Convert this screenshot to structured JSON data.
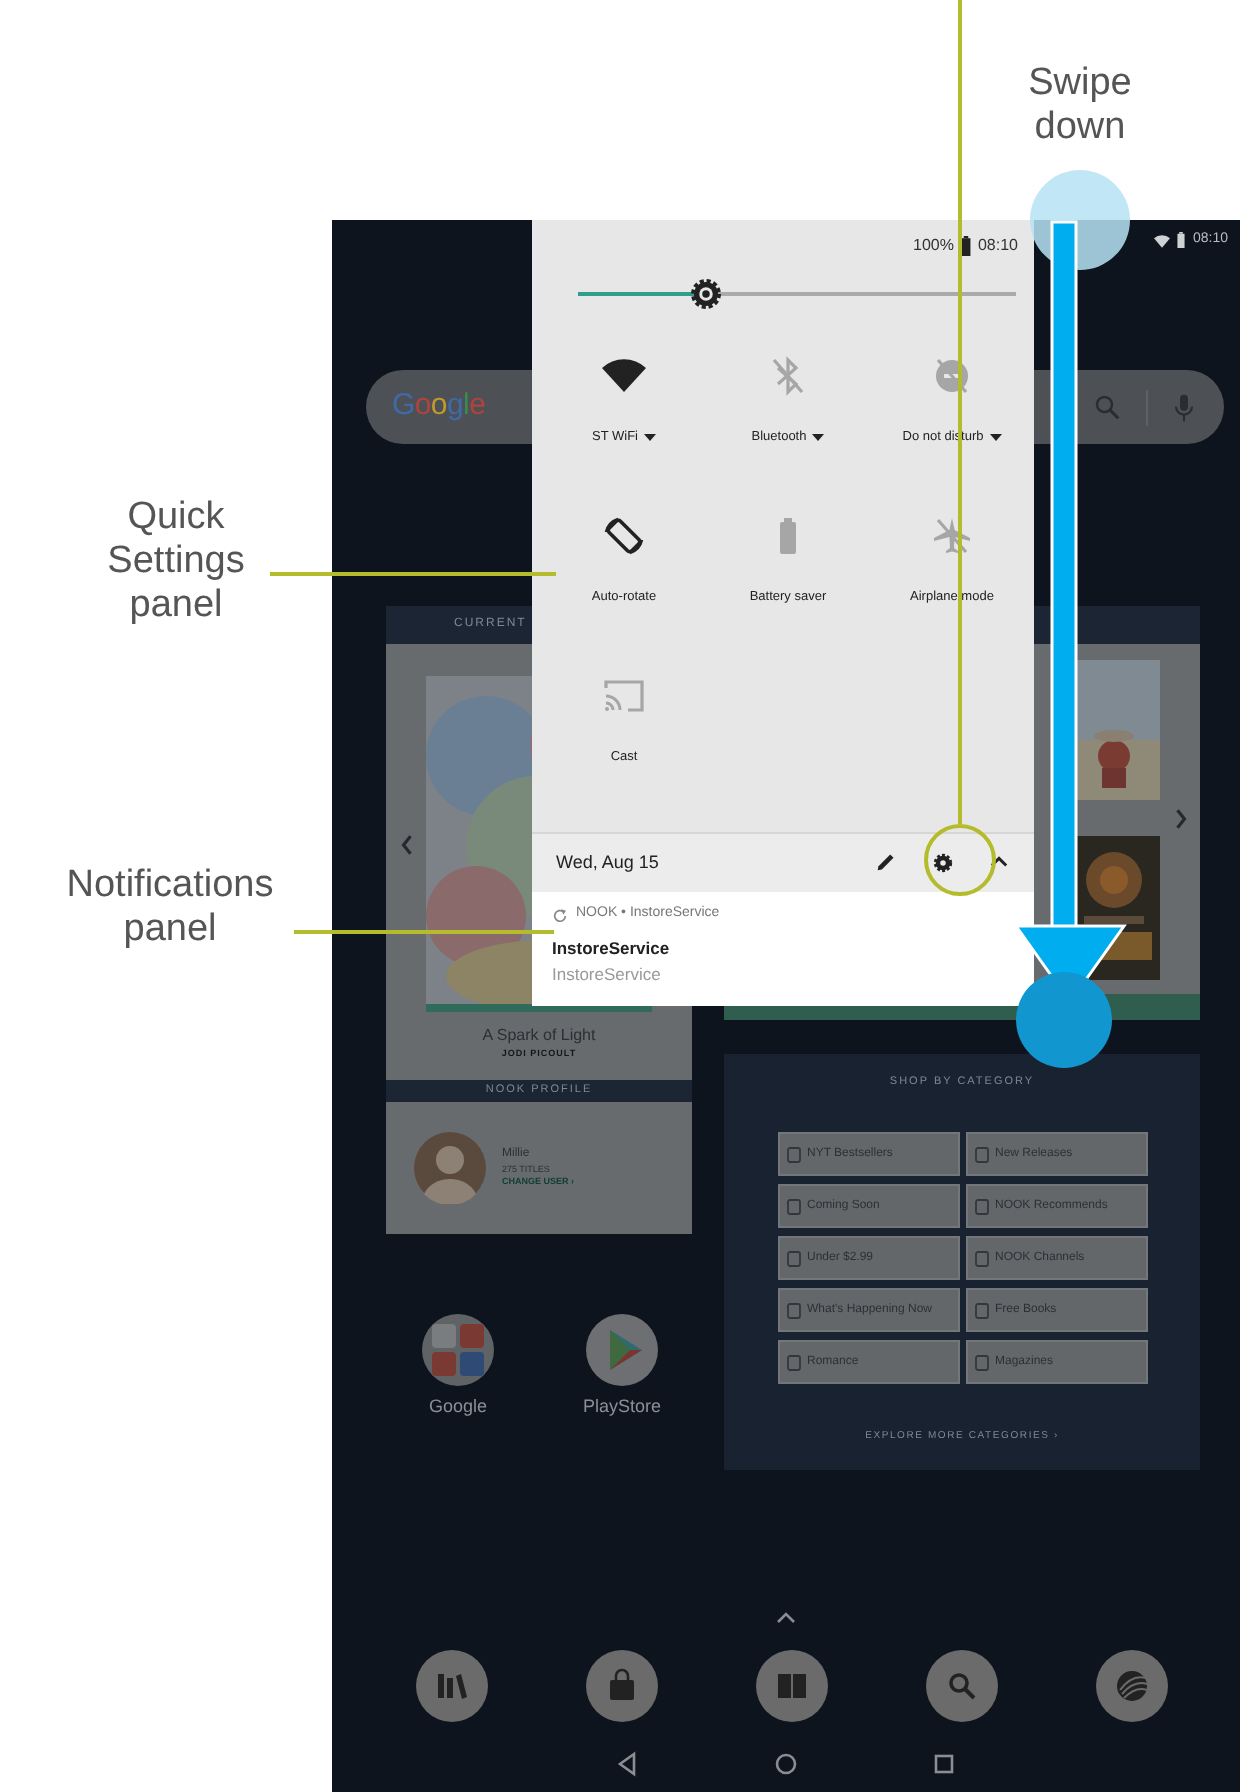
{
  "callouts": [
    {
      "text": "Quick Settings panel"
    },
    {
      "text": "Notifications panel"
    }
  ],
  "gesture": {
    "label": "Swipe down"
  },
  "status_bar": {
    "time": "08:10"
  },
  "search_bar": {
    "logo": "Google"
  },
  "current_reading": {
    "header": "CURRENT",
    "title": "A Spark of Light",
    "author": "JODI PICOULT"
  },
  "profile": {
    "header": "NOOK PROFILE",
    "name": "Millie",
    "count": "275 TITLES",
    "link": "CHANGE USER ›"
  },
  "apps": [
    {
      "label": "Google",
      "kind": "folder"
    },
    {
      "label": "PlayStore",
      "kind": "store"
    }
  ],
  "shop": {
    "title": "SHOP BY CATEGORY",
    "categories": [
      "NYT Bestsellers",
      "New Releases",
      "Coming Soon",
      "NOOK Recommends",
      "Under $2.99",
      "NOOK Channels",
      "What's Happening Now",
      "Free Books",
      "Romance",
      "Magazines"
    ],
    "footer": "EXPLORE MORE CATEGORIES ›"
  },
  "quick_settings": {
    "battery": "100%",
    "time": "08:10",
    "brightness": {
      "level": 0.29
    },
    "tiles": [
      {
        "label": "ST WiFi",
        "kind": "wifi",
        "on": true,
        "menu": true
      },
      {
        "label": "Bluetooth",
        "kind": "bluetooth",
        "on": false,
        "menu": true
      },
      {
        "label": "Do not disturb",
        "kind": "dnd",
        "on": false,
        "menu": true
      },
      {
        "label": "Auto-rotate",
        "kind": "rotate",
        "on": true,
        "menu": false
      },
      {
        "label": "Battery saver",
        "kind": "battery",
        "on": false,
        "menu": false
      },
      {
        "label": "Airplane mode",
        "kind": "airplane",
        "on": false,
        "menu": false
      },
      {
        "label": "Cast",
        "kind": "cast",
        "on": false,
        "menu": false
      }
    ],
    "date": "Wed, Aug 15"
  },
  "notification": {
    "header": "NOOK • InstoreService",
    "title": "InstoreService",
    "text": "InstoreService"
  }
}
